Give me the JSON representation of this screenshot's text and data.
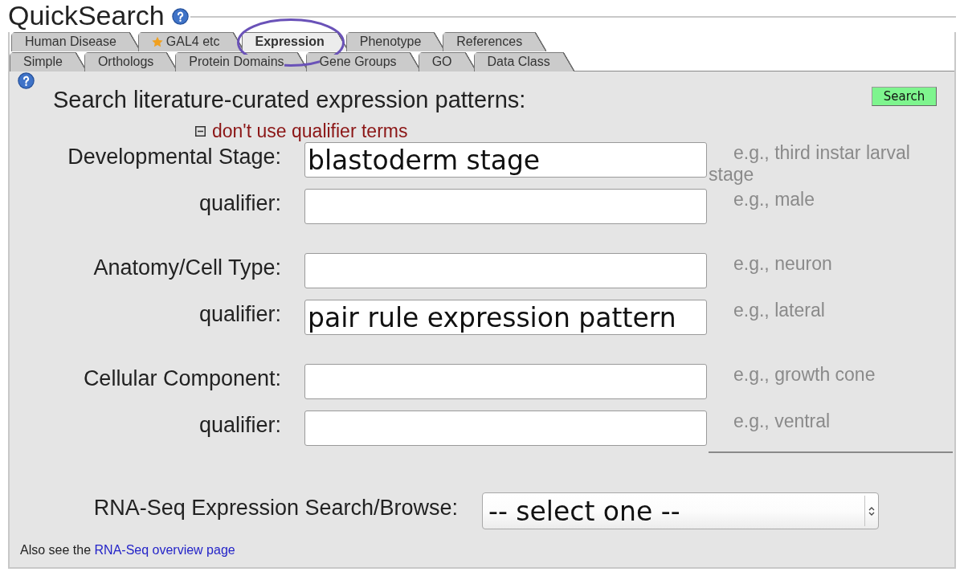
{
  "header": {
    "title": "QuickSearch"
  },
  "tab_rows": [
    {
      "tabs": [
        {
          "label": "Human Disease",
          "selected": false,
          "starred": false,
          "circled": false
        },
        {
          "label": "GAL4 etc",
          "selected": false,
          "starred": true,
          "circled": false
        },
        {
          "label": "Expression",
          "selected": true,
          "starred": false,
          "circled": true
        },
        {
          "label": "Phenotype",
          "selected": false,
          "starred": false,
          "circled": false
        },
        {
          "label": "References",
          "selected": false,
          "starred": false,
          "circled": false
        }
      ]
    },
    {
      "tabs": [
        {
          "label": "Simple",
          "selected": false,
          "starred": false,
          "circled": false
        },
        {
          "label": "Orthologs",
          "selected": false,
          "starred": false,
          "circled": false
        },
        {
          "label": "Protein Domains",
          "selected": false,
          "starred": false,
          "circled": false
        },
        {
          "label": "Gene Groups",
          "selected": false,
          "starred": false,
          "circled": false
        },
        {
          "label": "GO",
          "selected": false,
          "starred": false,
          "circled": false
        },
        {
          "label": "Data Class",
          "selected": false,
          "starred": false,
          "circled": false
        }
      ]
    }
  ],
  "panel": {
    "heading": "Search literature-curated expression patterns:",
    "search_button": "Search",
    "qualifier_toggle": {
      "label": "don't use qualifier terms",
      "expanded": true
    },
    "field_groups": [
      {
        "fields": [
          {
            "label": "Developmental Stage:",
            "value": "blastoderm stage",
            "hint": "e.g., third instar larval stage"
          },
          {
            "label": "qualifier:",
            "hint": "e.g., male"
          }
        ]
      },
      {
        "fields": [
          {
            "label": "Anatomy/Cell Type:",
            "hint": "e.g., neuron"
          },
          {
            "label": "qualifier:",
            "value": "pair rule expression pattern",
            "hint": "e.g., lateral"
          }
        ]
      },
      {
        "fields": [
          {
            "label": "Cellular Component:",
            "hint": "e.g., growth cone"
          },
          {
            "label": "qualifier:",
            "hint": "e.g., ventral"
          }
        ]
      }
    ],
    "rna_seq": {
      "label": "RNA-Seq Expression Search/Browse:",
      "select": "-- select one --"
    },
    "footer": {
      "text": "Also see the",
      "link": "RNA-Seq overview page"
    }
  }
}
